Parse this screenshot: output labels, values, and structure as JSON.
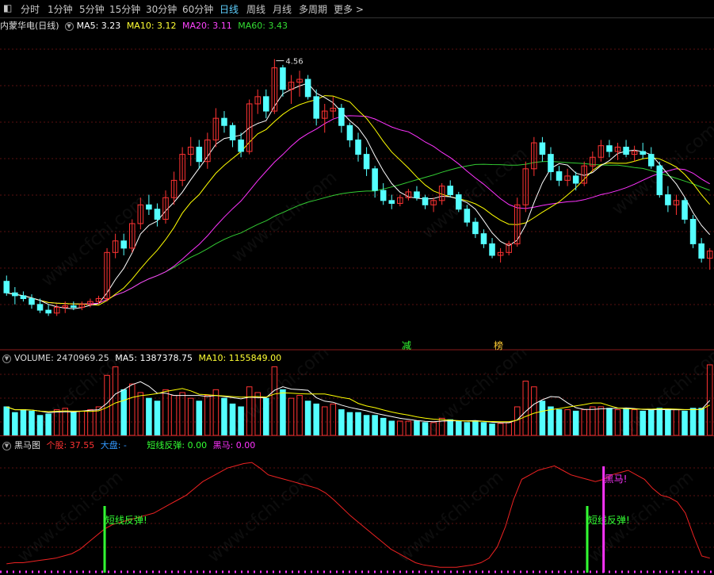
{
  "toolbar": {
    "items": [
      "分时",
      "1分钟",
      "5分钟",
      "15分钟",
      "30分钟",
      "60分钟",
      "日线",
      "周线",
      "月线",
      "多周期",
      "更多"
    ],
    "active": "日线",
    "more_arrow": ">"
  },
  "price_panel": {
    "stock_name": "内蒙华电(日线)",
    "ma5_label": "MA5: 3.23",
    "ma10_label": "MA10: 3.12",
    "ma20_label": "MA20: 3.11",
    "ma60_label": "MA60: 3.43",
    "high_marker": "4.56",
    "markers": [
      "减",
      "榜"
    ],
    "colors": {
      "ma5": "#ffffff",
      "ma10": "#ffff00",
      "ma20": "#ff33ff",
      "ma60": "#33cc33",
      "up": "#ff3333",
      "down": "#54ffff"
    }
  },
  "volume_panel": {
    "volume_label": "VOLUME: 2470969.25",
    "ma5_label": "MA5: 1387378.75",
    "ma10_label": "MA10: 1155849.00"
  },
  "indicator_panel": {
    "name": "黑马图",
    "stock_label": "个股: 37.55",
    "market_label": "大盘: -",
    "rebound_label": "短线反弹: 0.00",
    "darkhorse_label": "黑马: 0.00",
    "signal_rebound": "短线反弹!",
    "signal_darkhorse": "黑马!"
  },
  "watermark": "www.cfchi.com",
  "chart_data": [
    {
      "type": "candlestick",
      "title": "内蒙华电(日线)",
      "ohlc": [
        [
          3.02,
          3.06,
          2.92,
          2.94
        ],
        [
          2.94,
          2.98,
          2.86,
          2.92
        ],
        [
          2.92,
          2.95,
          2.88,
          2.9
        ],
        [
          2.9,
          2.93,
          2.83,
          2.86
        ],
        [
          2.86,
          2.9,
          2.8,
          2.82
        ],
        [
          2.82,
          2.86,
          2.78,
          2.8
        ],
        [
          2.8,
          2.86,
          2.78,
          2.84
        ],
        [
          2.84,
          2.88,
          2.8,
          2.85
        ],
        [
          2.85,
          2.88,
          2.82,
          2.84
        ],
        [
          2.84,
          2.88,
          2.82,
          2.86
        ],
        [
          2.86,
          2.9,
          2.84,
          2.88
        ],
        [
          2.88,
          2.92,
          2.86,
          2.9
        ],
        [
          2.9,
          3.25,
          2.88,
          3.22
        ],
        [
          3.22,
          3.35,
          3.18,
          3.3
        ],
        [
          3.3,
          3.35,
          3.2,
          3.25
        ],
        [
          3.25,
          3.45,
          3.22,
          3.42
        ],
        [
          3.42,
          3.6,
          3.38,
          3.55
        ],
        [
          3.55,
          3.62,
          3.48,
          3.52
        ],
        [
          3.52,
          3.56,
          3.4,
          3.45
        ],
        [
          3.45,
          3.65,
          3.42,
          3.6
        ],
        [
          3.6,
          3.78,
          3.55,
          3.72
        ],
        [
          3.72,
          3.95,
          3.68,
          3.9
        ],
        [
          3.9,
          4.02,
          3.82,
          3.95
        ],
        [
          3.95,
          4.0,
          3.8,
          3.85
        ],
        [
          3.85,
          4.05,
          3.8,
          4.0
        ],
        [
          4.0,
          4.22,
          3.95,
          4.15
        ],
        [
          4.15,
          4.2,
          4.05,
          4.1
        ],
        [
          4.1,
          4.12,
          3.95,
          4.0
        ],
        [
          4.0,
          4.05,
          3.88,
          3.92
        ],
        [
          3.92,
          4.28,
          3.9,
          4.25
        ],
        [
          4.25,
          4.35,
          4.18,
          4.3
        ],
        [
          4.3,
          4.35,
          4.15,
          4.2
        ],
        [
          4.2,
          4.56,
          4.18,
          4.5
        ],
        [
          4.5,
          4.52,
          4.3,
          4.35
        ],
        [
          4.35,
          4.45,
          4.25,
          4.4
        ],
        [
          4.4,
          4.48,
          4.3,
          4.42
        ],
        [
          4.42,
          4.45,
          4.28,
          4.3
        ],
        [
          4.3,
          4.35,
          4.1,
          4.15
        ],
        [
          4.15,
          4.25,
          4.05,
          4.2
        ],
        [
          4.2,
          4.3,
          4.15,
          4.22
        ],
        [
          4.22,
          4.25,
          4.05,
          4.1
        ],
        [
          4.1,
          4.12,
          3.95,
          4.0
        ],
        [
          4.0,
          4.05,
          3.85,
          3.9
        ],
        [
          3.9,
          3.95,
          3.75,
          3.8
        ],
        [
          3.8,
          3.82,
          3.6,
          3.65
        ],
        [
          3.65,
          3.7,
          3.55,
          3.58
        ],
        [
          3.58,
          3.62,
          3.52,
          3.56
        ],
        [
          3.56,
          3.62,
          3.54,
          3.6
        ],
        [
          3.6,
          3.66,
          3.58,
          3.64
        ],
        [
          3.64,
          3.68,
          3.58,
          3.6
        ],
        [
          3.6,
          3.62,
          3.52,
          3.55
        ],
        [
          3.55,
          3.6,
          3.5,
          3.58
        ],
        [
          3.58,
          3.7,
          3.55,
          3.68
        ],
        [
          3.68,
          3.72,
          3.6,
          3.62
        ],
        [
          3.62,
          3.64,
          3.5,
          3.52
        ],
        [
          3.52,
          3.55,
          3.4,
          3.43
        ],
        [
          3.43,
          3.46,
          3.32,
          3.35
        ],
        [
          3.35,
          3.38,
          3.25,
          3.28
        ],
        [
          3.28,
          3.32,
          3.18,
          3.2
        ],
        [
          3.2,
          3.25,
          3.15,
          3.22
        ],
        [
          3.22,
          3.3,
          3.2,
          3.28
        ],
        [
          3.28,
          3.6,
          3.26,
          3.55
        ],
        [
          3.55,
          3.85,
          3.5,
          3.8
        ],
        [
          3.8,
          4.02,
          3.75,
          3.98
        ],
        [
          3.98,
          4.02,
          3.85,
          3.9
        ],
        [
          3.9,
          3.95,
          3.72,
          3.78
        ],
        [
          3.78,
          3.82,
          3.68,
          3.72
        ],
        [
          3.72,
          3.8,
          3.68,
          3.75
        ],
        [
          3.75,
          3.78,
          3.65,
          3.7
        ],
        [
          3.7,
          3.85,
          3.68,
          3.82
        ],
        [
          3.82,
          3.92,
          3.78,
          3.88
        ],
        [
          3.88,
          4.0,
          3.85,
          3.96
        ],
        [
          3.96,
          4.0,
          3.88,
          3.92
        ],
        [
          3.92,
          3.98,
          3.86,
          3.95
        ],
        [
          3.95,
          4.0,
          3.88,
          3.9
        ],
        [
          3.9,
          3.96,
          3.85,
          3.92
        ],
        [
          3.92,
          3.98,
          3.87,
          3.9
        ],
        [
          3.9,
          3.95,
          3.8,
          3.82
        ],
        [
          3.82,
          3.85,
          3.6,
          3.62
        ],
        [
          3.62,
          3.68,
          3.5,
          3.55
        ],
        [
          3.55,
          3.62,
          3.48,
          3.58
        ],
        [
          3.58,
          3.6,
          3.42,
          3.45
        ],
        [
          3.45,
          3.48,
          3.25,
          3.28
        ],
        [
          3.28,
          3.32,
          3.15,
          3.18
        ],
        [
          3.18,
          3.25,
          3.1,
          3.23
        ]
      ],
      "ma_values": {
        "MA5": 3.23,
        "MA10": 3.12,
        "MA20": 3.11,
        "MA60": 3.43
      },
      "max_marker": 4.56,
      "ylim": [
        2.65,
        4.75
      ]
    },
    {
      "type": "bar",
      "title": "VOLUME",
      "values": [
        1.0,
        0.8,
        0.9,
        0.85,
        0.7,
        0.75,
        0.9,
        0.95,
        0.8,
        0.85,
        0.9,
        1.0,
        2.1,
        2.4,
        1.6,
        1.8,
        1.5,
        1.3,
        1.2,
        1.6,
        1.4,
        1.5,
        1.3,
        1.2,
        1.4,
        1.6,
        1.3,
        1.1,
        1.0,
        1.7,
        1.5,
        1.3,
        2.4,
        1.6,
        1.3,
        1.4,
        1.2,
        1.1,
        1.0,
        1.1,
        0.9,
        0.8,
        0.8,
        0.7,
        0.7,
        0.6,
        0.5,
        0.5,
        0.5,
        0.5,
        0.45,
        0.45,
        0.6,
        0.55,
        0.5,
        0.45,
        0.5,
        0.45,
        0.4,
        0.42,
        0.45,
        1.0,
        1.9,
        1.7,
        1.2,
        1.0,
        0.9,
        0.9,
        0.85,
        0.9,
        1.0,
        1.0,
        0.95,
        0.9,
        0.95,
        0.9,
        0.85,
        0.9,
        0.95,
        0.9,
        0.9,
        0.85,
        0.95,
        0.95,
        2.47
      ],
      "ma_values": {
        "MA5": 1387378.75,
        "MA10": 1155849.0
      },
      "last_value": 2470969.25
    },
    {
      "type": "line",
      "title": "黑马图",
      "series": [
        {
          "name": "个股",
          "values": [
            5,
            6,
            6,
            7,
            8,
            9,
            10,
            12,
            14,
            18,
            24,
            30,
            36,
            40,
            42,
            44,
            46,
            48,
            50,
            54,
            58,
            62,
            66,
            72,
            78,
            82,
            86,
            90,
            92,
            94,
            95,
            90,
            84,
            82,
            80,
            78,
            76,
            74,
            72,
            68,
            62,
            55,
            48,
            42,
            36,
            30,
            24,
            18,
            14,
            10,
            6,
            4,
            3,
            2,
            2,
            2,
            3,
            4,
            6,
            10,
            20,
            38,
            62,
            80,
            84,
            88,
            90,
            92,
            88,
            84,
            82,
            80,
            78,
            80,
            84,
            86,
            88,
            84,
            80,
            72,
            66,
            64,
            60,
            50,
            30,
            12,
            10
          ]
        }
      ],
      "signals": [
        {
          "label": "短线反弹!",
          "index": 12
        },
        {
          "label": "短线反弹!",
          "index": 71
        },
        {
          "label": "黑马!",
          "index": 73
        }
      ],
      "last_value": 37.55,
      "ylim": [
        0,
        100
      ]
    }
  ]
}
